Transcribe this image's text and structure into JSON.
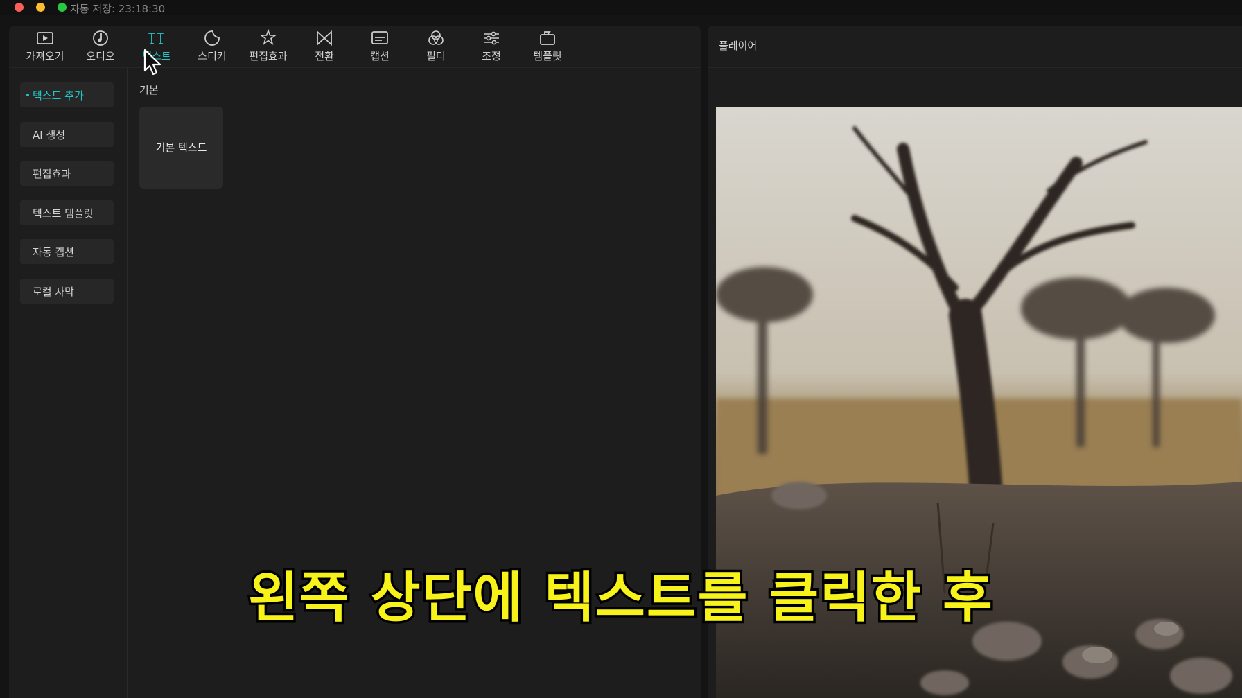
{
  "window": {
    "autosave_text": "자동 저장: 23:18:30"
  },
  "toolbar": {
    "items": [
      {
        "label": "가져오기",
        "icon": "media-import-icon"
      },
      {
        "label": "오디오",
        "icon": "audio-icon"
      },
      {
        "label": "텍스트",
        "icon": "text-icon"
      },
      {
        "label": "스티커",
        "icon": "sticker-icon"
      },
      {
        "label": "편집효과",
        "icon": "effects-icon"
      },
      {
        "label": "전환",
        "icon": "transition-icon"
      },
      {
        "label": "캡션",
        "icon": "caption-icon"
      },
      {
        "label": "필터",
        "icon": "filter-icon"
      },
      {
        "label": "조정",
        "icon": "adjust-icon"
      },
      {
        "label": "템플릿",
        "icon": "template-icon"
      }
    ],
    "active_index": 2,
    "accent_color": "#25c4c4"
  },
  "sidenav": {
    "items": [
      {
        "label": "텍스트 추가"
      },
      {
        "label": "AI 생성"
      },
      {
        "label": "편집효과"
      },
      {
        "label": "텍스트 템플릿"
      },
      {
        "label": "자동 캡션"
      },
      {
        "label": "로컬 자막"
      }
    ]
  },
  "content": {
    "section_title": "기본",
    "card_label": "기본 텍스트"
  },
  "player": {
    "title": "플레이어"
  },
  "subtitle": {
    "text": "왼쪽 상단에 텍스트를 클릭한 후",
    "color": "#f7f21a"
  }
}
